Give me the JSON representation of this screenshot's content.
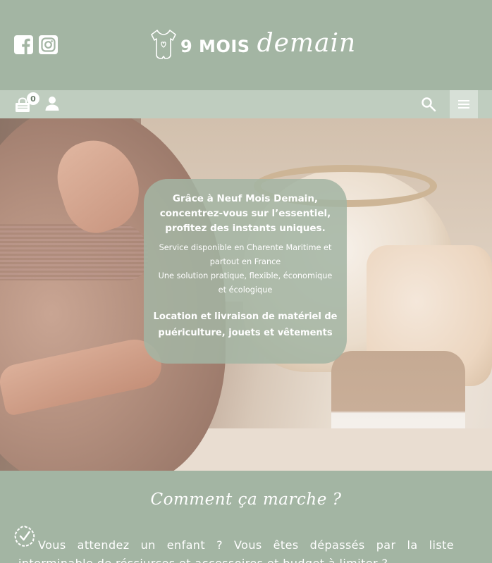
{
  "brand": {
    "logo_text": "9 MOIS",
    "logo_script": "demain"
  },
  "header": {
    "social": [
      {
        "icon": "facebook-icon"
      },
      {
        "icon": "instagram-icon"
      }
    ]
  },
  "navbar": {
    "cart_count": "0",
    "icons": [
      "cart-icon",
      "user-icon",
      "search-icon",
      "menu-icon"
    ]
  },
  "hero": {
    "headline_1": "Grâce à Neuf Mois Demain,",
    "headline_2": "concentrez-vous sur l’essentiel,",
    "headline_3": "profitez des instants uniques.",
    "sub_1": "Service disponible en Charente Maritime et",
    "sub_2": "partout en France",
    "sub_3": "Une solution pratique, flexible, économique",
    "sub_4": "et écologique",
    "cta_1": "Location et livraison de matériel de",
    "cta_2": "puériculture, jouets et vêtements"
  },
  "how": {
    "title": "Comment ça marche ?",
    "text_line_1": "Vous attendez un enfant ? Vous êtes dépassés par la liste",
    "text_line_2": "interminable de réssiurces et accessoires et budget à limiter ?"
  },
  "colors": {
    "sage": "#a3b5a3",
    "nav_bg": "#bfcdbf",
    "menu_bg": "#d7e0d7",
    "white": "#ffffff"
  }
}
